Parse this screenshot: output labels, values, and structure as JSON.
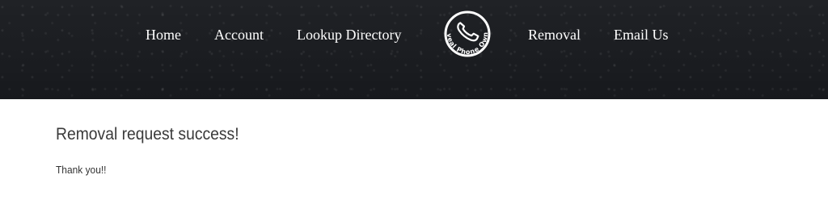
{
  "nav": {
    "home": "Home",
    "account": "Account",
    "lookup": "Lookup Directory",
    "removal": "Removal",
    "email": "Email Us"
  },
  "logo": {
    "text": "Reveal Phone Owner",
    "icon": "phone-handset-icon"
  },
  "main": {
    "title": "Removal request success!",
    "message": "Thank you!!"
  },
  "colors": {
    "header_bg": "#1a1c20",
    "nav_text": "#ffffff",
    "title_text": "#3a3a3a"
  }
}
